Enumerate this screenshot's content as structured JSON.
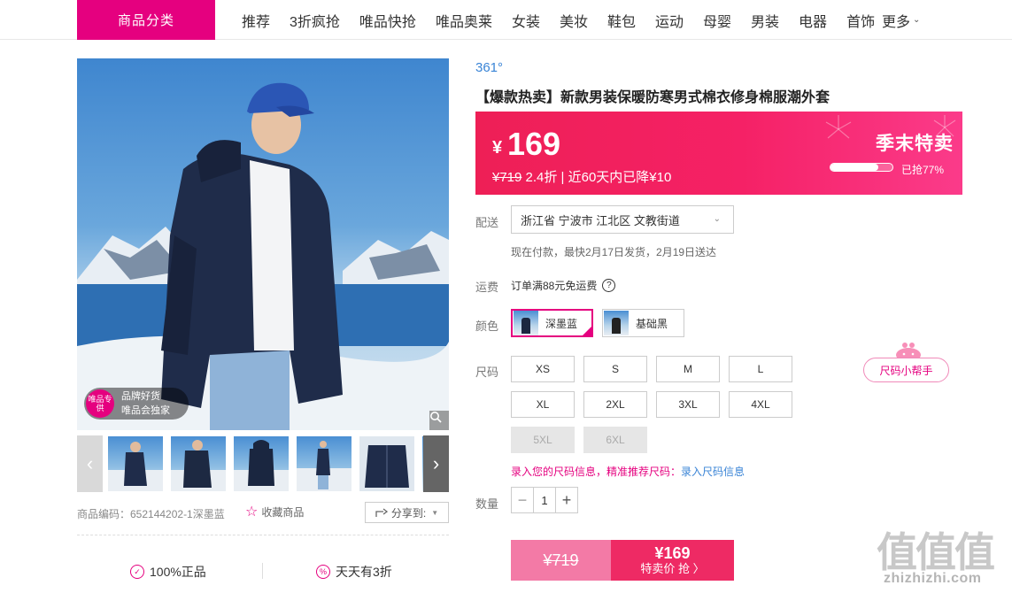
{
  "nav": {
    "category_button": "商品分类",
    "items": [
      "推荐",
      "3折疯抢",
      "唯品快抢",
      "唯品奥莱",
      "女装",
      "美妆",
      "鞋包",
      "运动",
      "母婴",
      "男装",
      "电器",
      "首饰"
    ],
    "more": "更多"
  },
  "gallery": {
    "badge_circle": "唯品专供",
    "badge_line1": "品牌好货",
    "badge_line2": "唯品会独家",
    "thumbnail_count": 6
  },
  "product_meta": {
    "code": "商品编码：652144202-1深墨蓝",
    "favorite": "收藏商品",
    "share": "分享到:"
  },
  "assurances": [
    "100%正品",
    "天天有3折"
  ],
  "product": {
    "brand": "361°",
    "title": "【爆款热卖】新款男装保暖防寒男式棉衣修身棉服潮外套",
    "currency": "¥",
    "price": "169",
    "price_sub_original": "¥719",
    "price_sub_rest": " 2.4折 | 近60天内已降¥10",
    "sale_label": "季末特卖",
    "sold_text": "已抢77%",
    "sold_fraction": 0.77
  },
  "delivery": {
    "label": "配送",
    "address": "浙江省 宁波市 江北区 文教街道",
    "ship_info": "现在付款，最快2月17日发货，2月19日送达"
  },
  "freight": {
    "label": "运费",
    "text": "订单满88元免运费"
  },
  "colors": {
    "label": "颜色",
    "options": [
      "深墨蓝",
      "基础黑"
    ],
    "selected": "深墨蓝"
  },
  "sizes": {
    "label": "尺码",
    "options": [
      "XS",
      "S",
      "M",
      "L",
      "XL",
      "2XL",
      "3XL",
      "4XL",
      "5XL",
      "6XL"
    ],
    "disabled": [
      "5XL",
      "6XL"
    ],
    "help": "尺码小帮手",
    "note": "录入您的尺码信息，精准推荐尺码：",
    "note_link": "录入尺码信息"
  },
  "quantity": {
    "label": "数量",
    "value": "1"
  },
  "buy": {
    "original": "¥719",
    "price": "¥169",
    "action": "特卖价 抢 〉"
  },
  "watermark": {
    "logo": "值值值",
    "url": "zhizhizhi.com"
  },
  "colors_theme": {
    "accent": "#e5007f",
    "price_red": "#ee1f56",
    "link_blue": "#3a84d6"
  }
}
